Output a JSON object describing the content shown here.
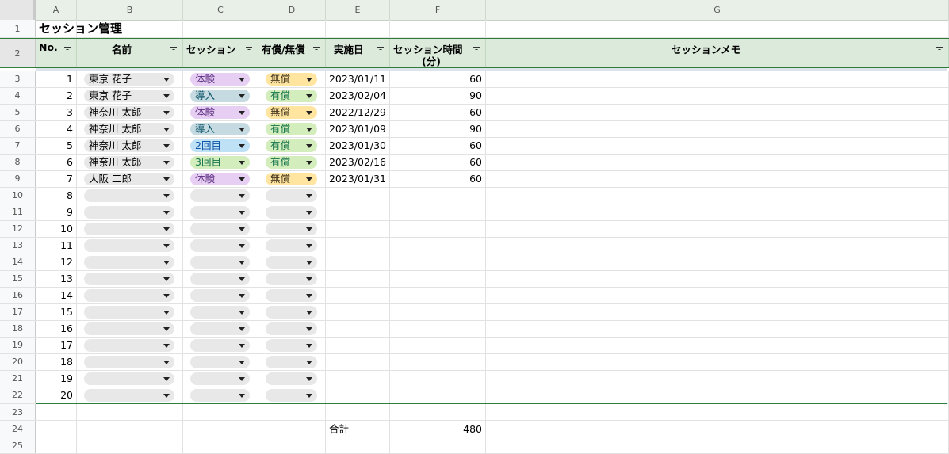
{
  "columns": [
    "A",
    "B",
    "C",
    "D",
    "E",
    "F",
    "G"
  ],
  "title": "セッション管理",
  "headers": {
    "no": "No.",
    "name": "名前",
    "session": "セッション",
    "paid": "有償/無償",
    "date": "実施日",
    "duration_line1": "セッション時間",
    "duration_line2": "(分)",
    "memo": "セッションメモ"
  },
  "rows": [
    {
      "rn": "3",
      "no": "1",
      "name": "東京 花子",
      "session": "体験",
      "session_color": "purple",
      "paid": "無償",
      "paid_color": "yellow",
      "date": "2023/01/11",
      "duration": "60"
    },
    {
      "rn": "4",
      "no": "2",
      "name": "東京 花子",
      "session": "導入",
      "session_color": "teal",
      "paid": "有償",
      "paid_color": "green",
      "date": "2023/02/04",
      "duration": "90"
    },
    {
      "rn": "5",
      "no": "3",
      "name": "神奈川 太郎",
      "session": "体験",
      "session_color": "purple",
      "paid": "無償",
      "paid_color": "yellow",
      "date": "2022/12/29",
      "duration": "60"
    },
    {
      "rn": "6",
      "no": "4",
      "name": "神奈川 太郎",
      "session": "導入",
      "session_color": "teal",
      "paid": "有償",
      "paid_color": "green",
      "date": "2023/01/09",
      "duration": "90"
    },
    {
      "rn": "7",
      "no": "5",
      "name": "神奈川 太郎",
      "session": "2回目",
      "session_color": "blue",
      "paid": "有償",
      "paid_color": "green",
      "date": "2023/01/30",
      "duration": "60"
    },
    {
      "rn": "8",
      "no": "6",
      "name": "神奈川 太郎",
      "session": "3回目",
      "session_color": "green",
      "paid": "有償",
      "paid_color": "green",
      "date": "2023/02/16",
      "duration": "60"
    },
    {
      "rn": "9",
      "no": "7",
      "name": "大阪 二郎",
      "session": "体験",
      "session_color": "purple",
      "paid": "無償",
      "paid_color": "yellow",
      "date": "2023/01/31",
      "duration": "60"
    },
    {
      "rn": "10",
      "no": "8",
      "name": "",
      "session": "",
      "session_color": "plain",
      "paid": "",
      "paid_color": "plain",
      "date": "",
      "duration": ""
    },
    {
      "rn": "11",
      "no": "9",
      "name": "",
      "session": "",
      "session_color": "plain",
      "paid": "",
      "paid_color": "plain",
      "date": "",
      "duration": ""
    },
    {
      "rn": "12",
      "no": "10",
      "name": "",
      "session": "",
      "session_color": "plain",
      "paid": "",
      "paid_color": "plain",
      "date": "",
      "duration": ""
    },
    {
      "rn": "13",
      "no": "11",
      "name": "",
      "session": "",
      "session_color": "plain",
      "paid": "",
      "paid_color": "plain",
      "date": "",
      "duration": ""
    },
    {
      "rn": "14",
      "no": "12",
      "name": "",
      "session": "",
      "session_color": "plain",
      "paid": "",
      "paid_color": "plain",
      "date": "",
      "duration": ""
    },
    {
      "rn": "15",
      "no": "13",
      "name": "",
      "session": "",
      "session_color": "plain",
      "paid": "",
      "paid_color": "plain",
      "date": "",
      "duration": ""
    },
    {
      "rn": "16",
      "no": "14",
      "name": "",
      "session": "",
      "session_color": "plain",
      "paid": "",
      "paid_color": "plain",
      "date": "",
      "duration": ""
    },
    {
      "rn": "17",
      "no": "15",
      "name": "",
      "session": "",
      "session_color": "plain",
      "paid": "",
      "paid_color": "plain",
      "date": "",
      "duration": ""
    },
    {
      "rn": "18",
      "no": "16",
      "name": "",
      "session": "",
      "session_color": "plain",
      "paid": "",
      "paid_color": "plain",
      "date": "",
      "duration": ""
    },
    {
      "rn": "19",
      "no": "17",
      "name": "",
      "session": "",
      "session_color": "plain",
      "paid": "",
      "paid_color": "plain",
      "date": "",
      "duration": ""
    },
    {
      "rn": "20",
      "no": "18",
      "name": "",
      "session": "",
      "session_color": "plain",
      "paid": "",
      "paid_color": "plain",
      "date": "",
      "duration": ""
    },
    {
      "rn": "21",
      "no": "19",
      "name": "",
      "session": "",
      "session_color": "plain",
      "paid": "",
      "paid_color": "plain",
      "date": "",
      "duration": ""
    },
    {
      "rn": "22",
      "no": "20",
      "name": "",
      "session": "",
      "session_color": "plain",
      "paid": "",
      "paid_color": "plain",
      "date": "",
      "duration": ""
    }
  ],
  "total": {
    "label": "合計",
    "value": "480"
  },
  "row_numbers": {
    "title": "1",
    "header": "2",
    "blank": "23",
    "total": "24",
    "partial": "25"
  }
}
